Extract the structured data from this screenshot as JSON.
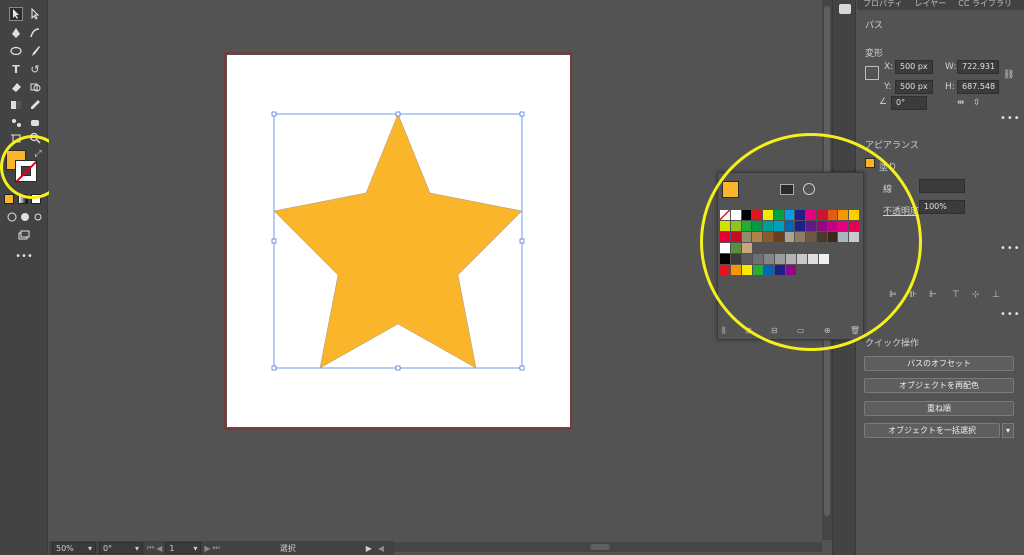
{
  "status_bar": {
    "zoom": "50%",
    "rotate": "0°",
    "artboard": "1",
    "tool": "選択"
  },
  "panel": {
    "tabs": [
      "プロパティ",
      "レイヤー",
      "CC ライブラリ"
    ],
    "selection_type": "パス",
    "transform": {
      "title": "変形",
      "x_label": "X:",
      "x_value": "500 px",
      "y_label": "Y:",
      "y_value": "500 px",
      "w_label": "W:",
      "w_value": "722.931",
      "h_label": "H:",
      "h_value": "687.548",
      "angle_value": "0°"
    },
    "appearance": {
      "title": "アピアランス",
      "fill_label": "塗り",
      "stroke_label": "線",
      "opacity_label": "不透明度",
      "opacity_value": "100%"
    },
    "quick_actions": {
      "title": "クイック操作",
      "offset_path": "パスのオフセット",
      "recolor": "オブジェクトを再配色",
      "arrange": "重ね順",
      "select_same": "オブジェクトを一括選択"
    }
  },
  "colors": {
    "fill": "#fbb52b",
    "highlight": "#f5ef1a",
    "artboard_border": "#7a3b36",
    "selection": "#4a7fd9"
  },
  "swatches": {
    "rows": [
      [
        "#ffffff",
        "#ffffff",
        "#000000",
        "#e1141b",
        "#f6ea00",
        "#00a43d",
        "#00a0e8",
        "#1c2088",
        "#e5007e",
        "#c9162e",
        "#e55b13",
        "#f39800",
        "#fdd000"
      ],
      [
        "#d4e000",
        "#8fc31f",
        "#22ac38",
        "#009944",
        "#009e96",
        "#00a0c1",
        "#0068b7",
        "#1d2088",
        "#601986",
        "#920783",
        "#be0081",
        "#e4007f",
        "#e5004f"
      ],
      [
        "#e60033",
        "#c30d23",
        "#958b6e",
        "#b28146",
        "#8a5a2b",
        "#6b3e1c",
        "#b1a28f",
        "#8f7b64",
        "#6c5a45",
        "#4a3a2b",
        "#3a2a1c",
        "#a5b6bf",
        "#c7cbcf"
      ],
      [
        "#ffffff",
        "#5e8d3a",
        "#c8a77d"
      ],
      [
        "#000000",
        "#3a3a3a",
        "#5a5a5a",
        "#6f6f6f",
        "#858585",
        "#9c9c9c",
        "#b2b2b2",
        "#c8c8c8",
        "#dedede",
        "#f0f0f0"
      ],
      [
        "#e1141b",
        "#f39800",
        "#f6ea00",
        "#22ac38",
        "#0068b7",
        "#1d2088",
        "#920783"
      ]
    ]
  }
}
